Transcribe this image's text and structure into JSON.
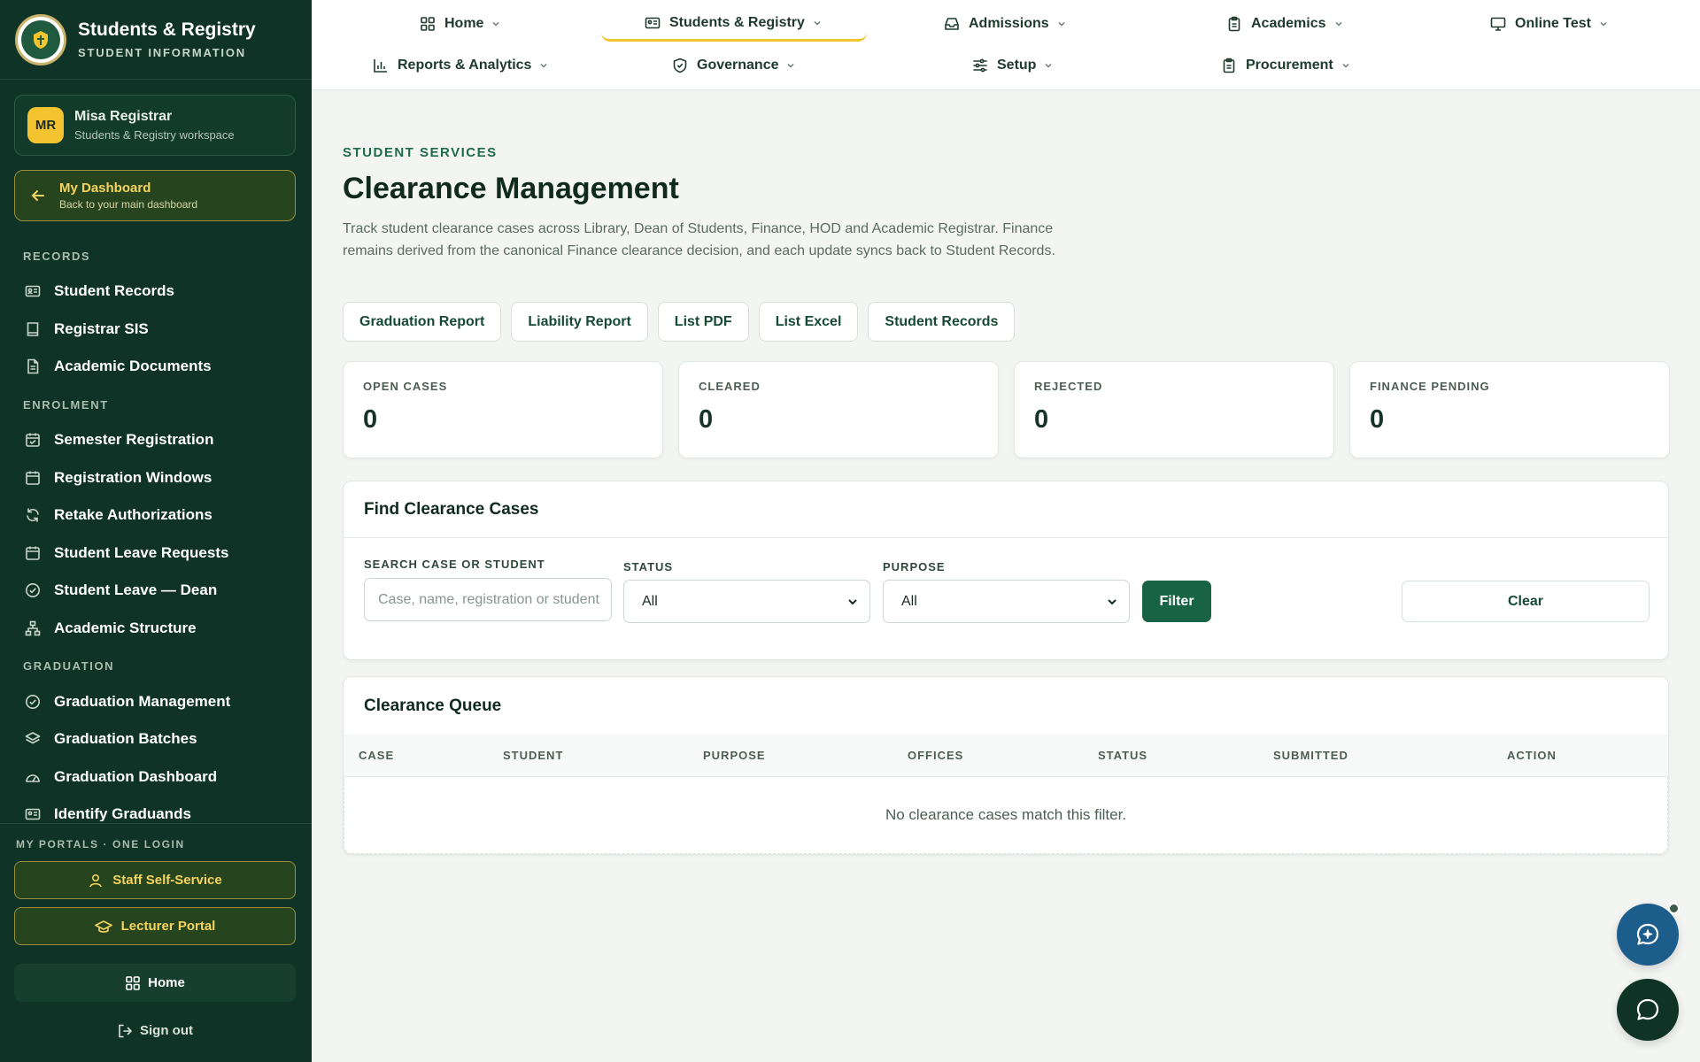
{
  "sidebar": {
    "brand_title": "Students & Registry",
    "brand_subtitle": "STUDENT INFORMATION",
    "user": {
      "initials": "MR",
      "name": "Misa Registrar",
      "role": "Students & Registry workspace"
    },
    "dashboard": {
      "title": "My Dashboard",
      "subtitle": "Back to your main dashboard"
    },
    "sections": [
      {
        "title": "RECORDS",
        "items": [
          {
            "label": "Student Records",
            "icon": "id-card-icon"
          },
          {
            "label": "Registrar SIS",
            "icon": "book-icon"
          },
          {
            "label": "Academic Documents",
            "icon": "document-icon"
          }
        ]
      },
      {
        "title": "ENROLMENT",
        "items": [
          {
            "label": "Semester Registration",
            "icon": "calendar-check-icon"
          },
          {
            "label": "Registration Windows",
            "icon": "calendar-icon"
          },
          {
            "label": "Retake Authorizations",
            "icon": "refresh-icon"
          },
          {
            "label": "Student Leave Requests",
            "icon": "calendar-icon"
          },
          {
            "label": "Student Leave — Dean",
            "icon": "check-circle-icon"
          },
          {
            "label": "Academic Structure",
            "icon": "hierarchy-icon"
          }
        ]
      },
      {
        "title": "GRADUATION",
        "items": [
          {
            "label": "Graduation Management",
            "icon": "check-circle-icon"
          },
          {
            "label": "Graduation Batches",
            "icon": "layers-icon"
          },
          {
            "label": "Graduation Dashboard",
            "icon": "gauge-icon"
          },
          {
            "label": "Identify Graduands",
            "icon": "id-card-icon"
          }
        ]
      }
    ],
    "portals_label": "MY PORTALS · ONE LOGIN",
    "portals": [
      "Staff Self-Service",
      "Lecturer Portal"
    ],
    "home_label": "Home",
    "signout_label": "Sign out"
  },
  "topnav": {
    "items": [
      {
        "label": "Home",
        "icon": "grid-icon"
      },
      {
        "label": "Students & Registry",
        "icon": "id-card-icon",
        "active": true
      },
      {
        "label": "Admissions",
        "icon": "inbox-icon"
      },
      {
        "label": "Academics",
        "icon": "clipboard-icon"
      },
      {
        "label": "Online Test",
        "icon": "monitor-icon"
      },
      {
        "label": "Reports & Analytics",
        "icon": "bar-chart-icon"
      },
      {
        "label": "Governance",
        "icon": "shield-icon"
      },
      {
        "label": "Setup",
        "icon": "sliders-icon"
      },
      {
        "label": "Procurement",
        "icon": "clipboard-icon"
      }
    ]
  },
  "page": {
    "eyebrow": "STUDENT SERVICES",
    "title": "Clearance Management",
    "description": "Track student clearance cases across Library, Dean of Students, Finance, HOD and Academic Registrar. Finance remains derived from the canonical Finance clearance decision, and each update syncs back to Student Records.",
    "actions": [
      "Graduation Report",
      "Liability Report",
      "List PDF",
      "List Excel",
      "Student Records"
    ]
  },
  "stats": [
    {
      "label": "OPEN CASES",
      "value": "0"
    },
    {
      "label": "CLEARED",
      "value": "0"
    },
    {
      "label": "REJECTED",
      "value": "0"
    },
    {
      "label": "FINANCE PENDING",
      "value": "0"
    }
  ],
  "filters": {
    "title": "Find Clearance Cases",
    "search_label": "SEARCH CASE OR STUDENT",
    "search_placeholder": "Case, name, registration or student",
    "status_label": "STATUS",
    "status_value": "All",
    "purpose_label": "PURPOSE",
    "purpose_value": "All",
    "filter_label": "Filter",
    "clear_label": "Clear"
  },
  "queue": {
    "title": "Clearance Queue",
    "columns": [
      "CASE",
      "STUDENT",
      "PURPOSE",
      "OFFICES",
      "STATUS",
      "SUBMITTED",
      "ACTION"
    ],
    "empty_message": "No clearance cases match this filter."
  },
  "colors": {
    "sidebar_bg": "#0f3326",
    "accent_gold": "#f4c430",
    "primary_green": "#176344",
    "ai_fab": "#1d5d8c"
  }
}
